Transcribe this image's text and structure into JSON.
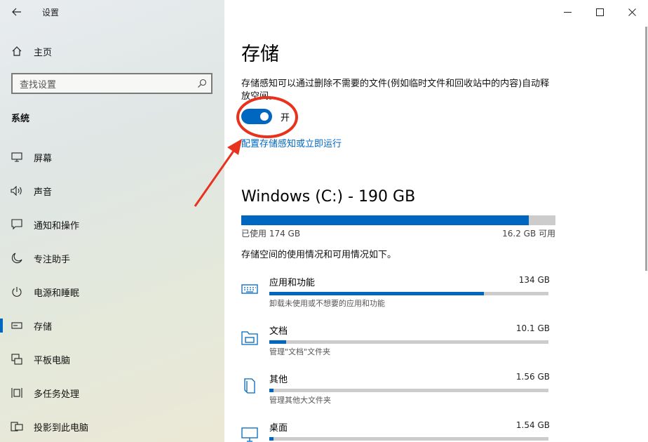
{
  "app_title": "设置",
  "nav": {
    "home_label": "主页",
    "search_placeholder": "查找设置",
    "section_title": "系统",
    "items": [
      {
        "label": "屏幕",
        "icon": "display-icon"
      },
      {
        "label": "声音",
        "icon": "sound-icon"
      },
      {
        "label": "通知和操作",
        "icon": "notification-icon"
      },
      {
        "label": "专注助手",
        "icon": "moon-icon"
      },
      {
        "label": "电源和睡眠",
        "icon": "power-icon"
      },
      {
        "label": "存储",
        "icon": "storage-icon",
        "active": true
      },
      {
        "label": "平板电脑",
        "icon": "tablet-icon"
      },
      {
        "label": "多任务处理",
        "icon": "multitask-icon"
      },
      {
        "label": "投影到此电脑",
        "icon": "project-icon"
      }
    ]
  },
  "main": {
    "title": "存储",
    "description": "存储感知可以通过删除不需要的文件(例如临时文件和回收站中的内容)自动释放空间。",
    "toggle_state": "开",
    "toggle_on": true,
    "config_link": "配置存储感知或立即运行",
    "drive": {
      "title": "Windows (C:) - 190 GB",
      "used_label": "已使用 174 GB",
      "available_label": "16.2 GB 可用",
      "used_fraction": 0.915
    },
    "usage_desc": "存储空间的使用情况和可用情况如下。",
    "categories": [
      {
        "name": "应用和功能",
        "size": "134 GB",
        "sub": "卸载未使用或不想要的应用和功能",
        "fraction": 0.77,
        "icon": "keyboard-icon"
      },
      {
        "name": "文档",
        "size": "10.1 GB",
        "sub": "管理\"文档\"文件夹",
        "fraction": 0.06,
        "icon": "documents-folder-icon"
      },
      {
        "name": "其他",
        "size": "1.56 GB",
        "sub": "管理其他大文件夹",
        "fraction": 0.01,
        "icon": "other-folder-icon"
      },
      {
        "name": "桌面",
        "size": "1.54 GB",
        "sub": "",
        "fraction": 0.01,
        "icon": "monitor-icon"
      }
    ]
  },
  "colors": {
    "accent": "#0067c0",
    "annotation": "#e8321e"
  }
}
